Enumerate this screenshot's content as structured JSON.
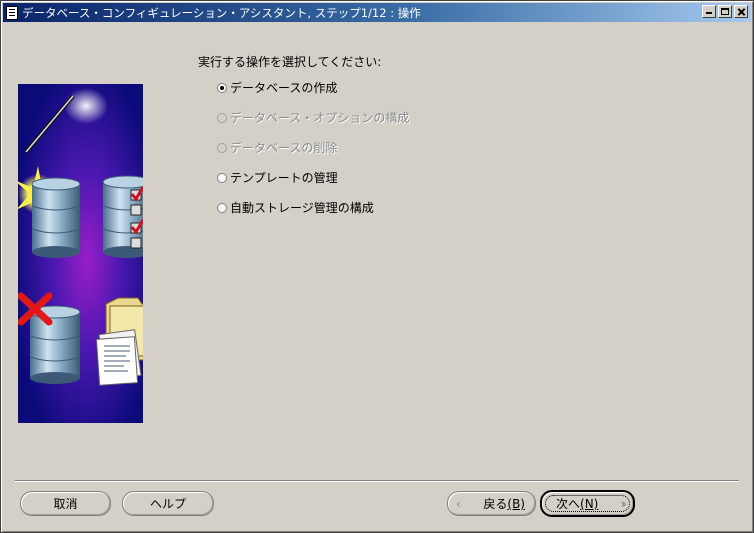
{
  "window": {
    "title": "データベース・コンフィギュレーション・アシスタント, ステップ1/12 : 操作"
  },
  "main": {
    "prompt": "実行する操作を選択してください:",
    "options": [
      {
        "label": "データベースの作成",
        "selected": true,
        "enabled": true
      },
      {
        "label": "データベース・オプションの構成",
        "selected": false,
        "enabled": false
      },
      {
        "label": "データベースの削除",
        "selected": false,
        "enabled": false
      },
      {
        "label": "テンプレートの管理",
        "selected": false,
        "enabled": true
      },
      {
        "label": "自動ストレージ管理の構成",
        "selected": false,
        "enabled": true
      }
    ]
  },
  "buttons": {
    "cancel": "取消",
    "help": "ヘルプ",
    "back_text": "戻る",
    "back_mnemonic": "(B)",
    "next_text": "次へ",
    "next_mnemonic": "(N)"
  },
  "icons": {
    "window": "app-icon",
    "illustration": [
      "magic-wand-icon",
      "sparkle-icon",
      "database-icon",
      "checklist-icon",
      "delete-x-icon",
      "folder-documents-icon"
    ]
  },
  "colors": {
    "title_bar_start": "#0a246a",
    "title_bar_end": "#a6caf0",
    "window_bg": "#d4d0c8",
    "illustration_bg": "#0b0b7a",
    "check_red": "#d01020"
  }
}
